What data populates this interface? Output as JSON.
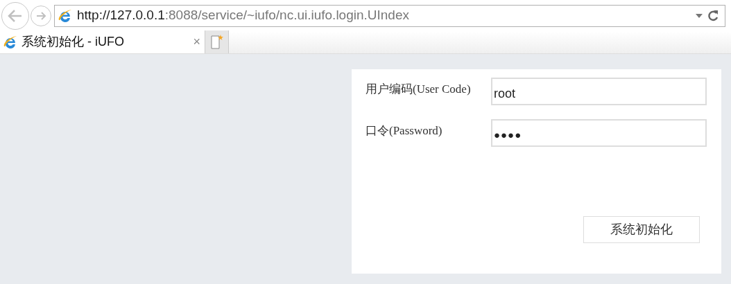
{
  "browser": {
    "address": {
      "host": "http://127.0.0.1",
      "path": ":8088/service/~iufo/nc.ui.iufo.login.UIndex"
    },
    "tabs": [
      {
        "title": "系统初始化 - iUFO",
        "close": "×",
        "selected": true
      }
    ]
  },
  "form": {
    "fields": [
      {
        "label": "用户编码(User Code)",
        "value": "root",
        "kind": "text"
      },
      {
        "label": "口令(Password)",
        "value": "●●●●",
        "kind": "password"
      }
    ],
    "button": "系统初始化"
  }
}
